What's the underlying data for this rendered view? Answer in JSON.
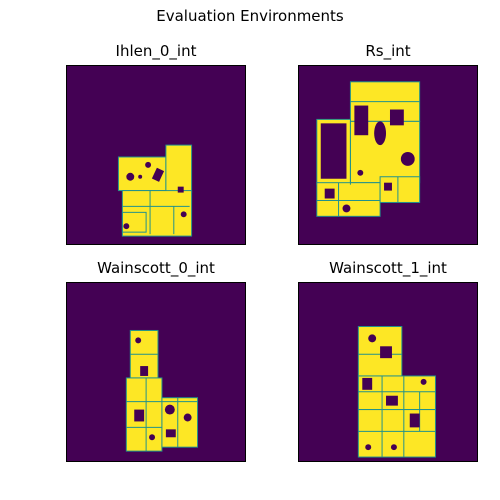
{
  "figure": {
    "title": "Evaluation Environments"
  },
  "colors": {
    "background": "#440154",
    "free_space": "#fde725",
    "boundary": "#21918c",
    "frame": "#000000"
  },
  "panels": [
    {
      "title": "Ihlen_0_int"
    },
    {
      "title": "Rs_int"
    },
    {
      "title": "Wainscott_0_int"
    },
    {
      "title": "Wainscott_1_int"
    }
  ]
}
